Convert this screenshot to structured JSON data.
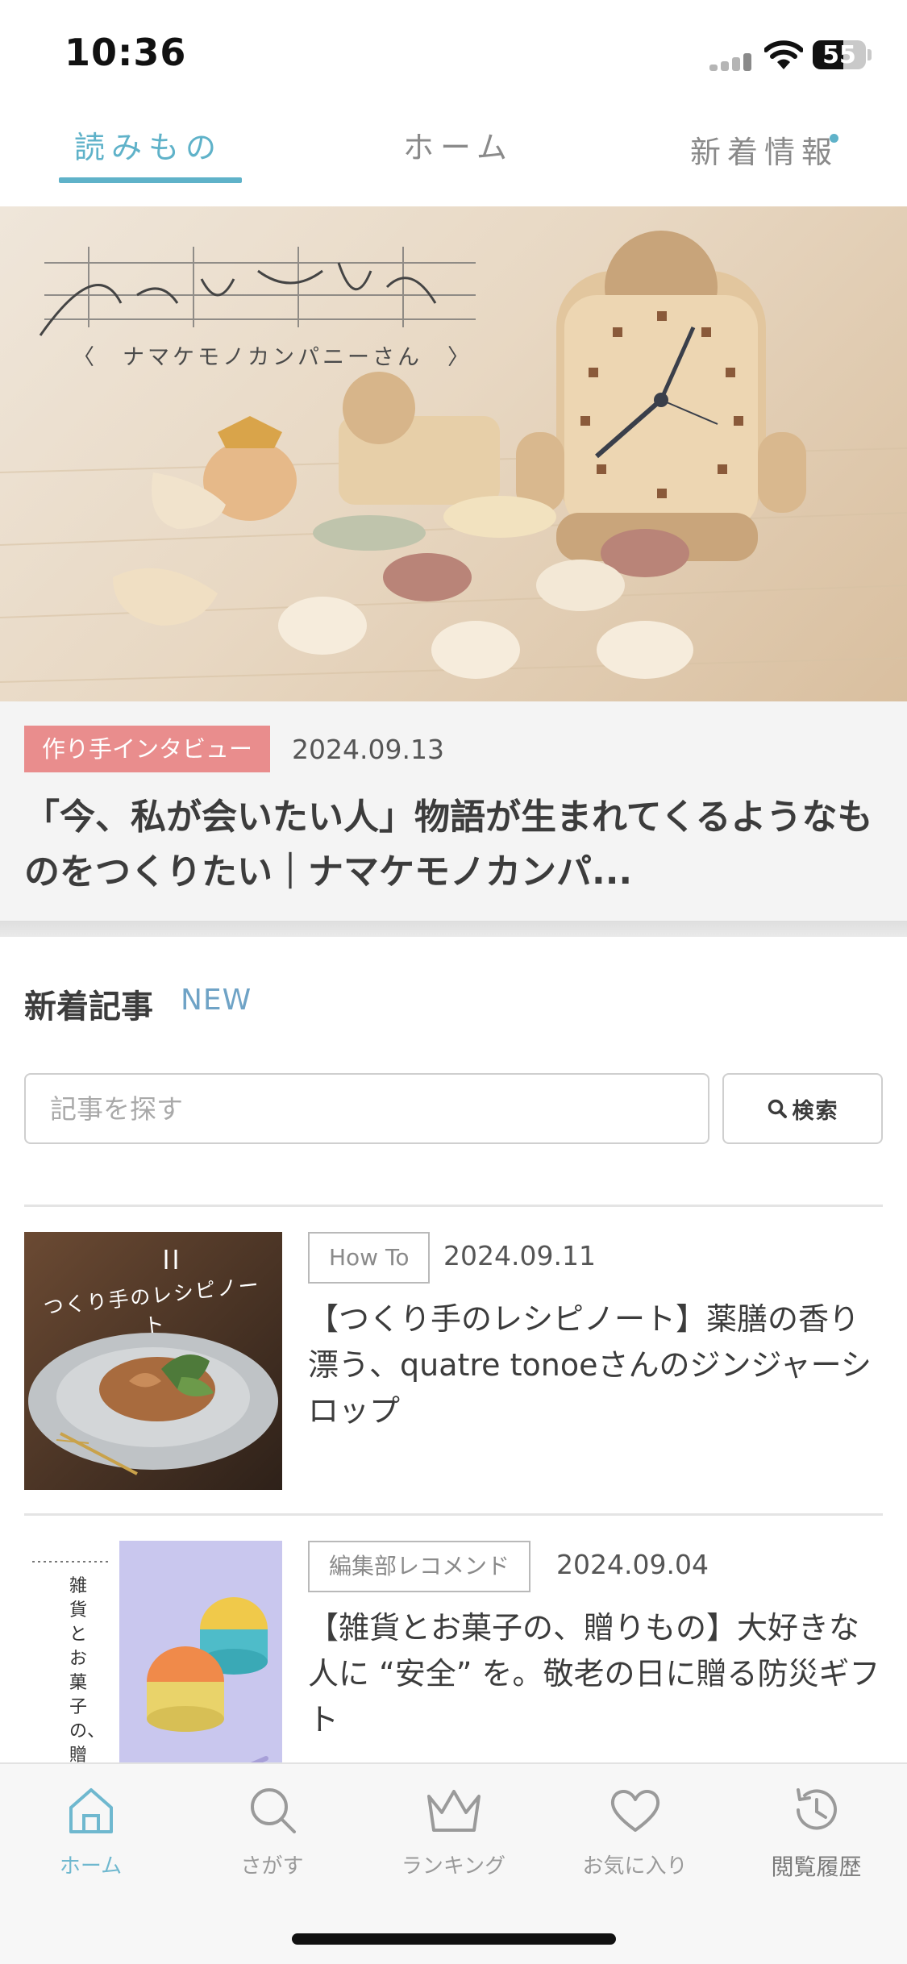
{
  "status_bar": {
    "time": "10:36",
    "battery_level": "55"
  },
  "top_tabs": [
    {
      "label": "読みもの",
      "active": true
    },
    {
      "label": "ホーム",
      "active": false
    },
    {
      "label": "新着情報",
      "active": false,
      "has_dot": true
    }
  ],
  "hero": {
    "image_subtitle": "〈　ナマケモノカンパニーさん　〉",
    "badge": "作り手インタビュー",
    "date": "2024.09.13",
    "title": "「今、私が会いたい人」物語が生まれてくるようなものをつくりたい｜ナマケモノカンパ..."
  },
  "new_articles": {
    "title": "新着記事",
    "subtitle": "NEW",
    "search_placeholder": "記事を探す",
    "search_button": "検索",
    "items": [
      {
        "tag": "How To",
        "date": "2024.09.11",
        "title": "【つくり手のレシピノート】薬膳の香り漂う、quatre tonoeさんのジンジャーシロップ",
        "thumb_caption": "つくり手のレシピノート"
      },
      {
        "tag": "編集部レコメンド",
        "date": "2024.09.04",
        "title": "【雑貨とお菓子の、贈りもの】大好きな人に “安全” を。敬老の日に贈る防災ギフト",
        "thumb_caption": "雑貨とお菓子の、贈りもの"
      }
    ]
  },
  "bottom_nav": [
    {
      "label": "ホーム",
      "icon": "home-icon",
      "active": true
    },
    {
      "label": "さがす",
      "icon": "search-icon",
      "active": false
    },
    {
      "label": "ランキング",
      "icon": "crown-icon",
      "active": false
    },
    {
      "label": "お気に入り",
      "icon": "heart-icon",
      "active": false
    },
    {
      "label": "閲覧履歴",
      "icon": "history-icon",
      "active": false
    }
  ],
  "colors": {
    "accent": "#5fb2c9",
    "badge": "#e98d8d",
    "new_label": "#6fa3c6",
    "nav_active": "#6fb8cf"
  }
}
